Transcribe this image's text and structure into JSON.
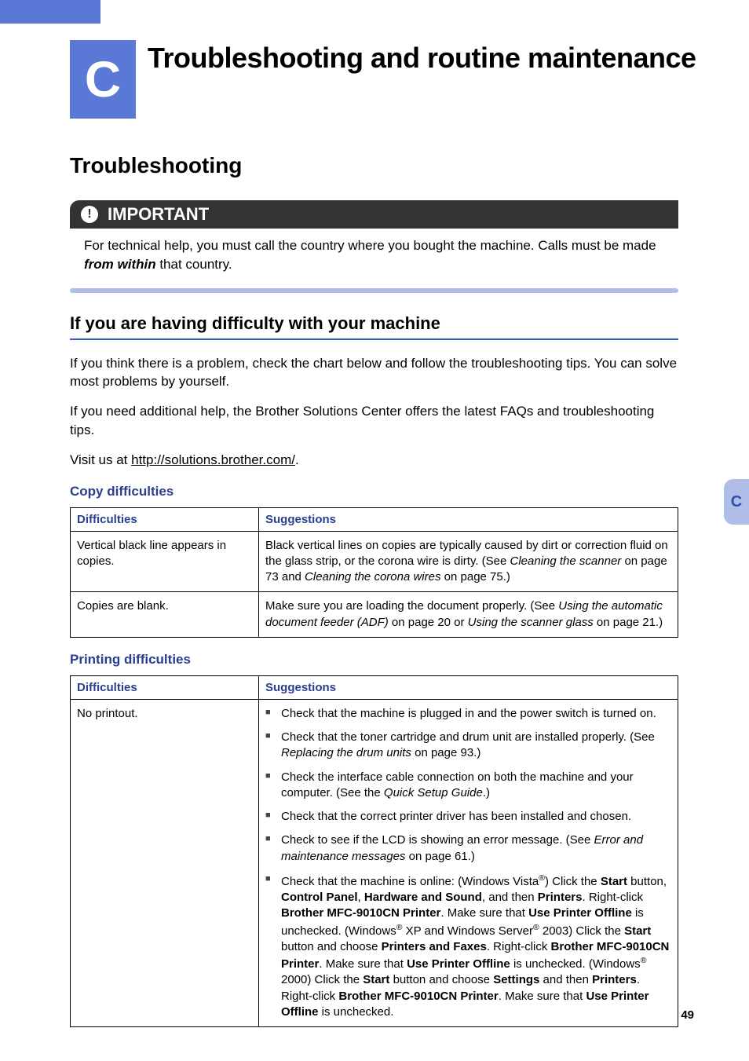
{
  "header": {
    "letter": "C",
    "title": "Troubleshooting and routine maintenance"
  },
  "section_title": "Troubleshooting",
  "important": {
    "label": "IMPORTANT",
    "text_before": "For technical help, you must call the country where you bought the machine. Calls must be made ",
    "text_em": "from within",
    "text_after": " that country."
  },
  "h2": "If you are having difficulty with your machine",
  "p1": "If you think there is a problem, check the chart below and follow the troubleshooting tips. You can solve most problems by yourself.",
  "p2": "If you need additional help, the Brother Solutions Center offers the latest FAQs and troubleshooting tips.",
  "p3_pre": "Visit us at ",
  "p3_url": "http://solutions.brother.com/",
  "p3_post": ".",
  "copy": {
    "title": "Copy difficulties",
    "h_diff": "Difficulties",
    "h_sugg": "Suggestions",
    "r1_d": "Vertical black line appears in copies.",
    "r1_s_a": "Black vertical lines on copies are typically caused by dirt or correction fluid on the glass strip, or the corona wire is dirty. (See ",
    "r1_s_b": "Cleaning the scanner",
    "r1_s_c": " on page 73 and ",
    "r1_s_d": "Cleaning the corona wires",
    "r1_s_e": " on page 75.)",
    "r2_d": "Copies are blank.",
    "r2_s_a": "Make sure you are loading the document properly. (See ",
    "r2_s_b": "Using the automatic document feeder (ADF)",
    "r2_s_c": " on page 20 or ",
    "r2_s_d": "Using the scanner glass",
    "r2_s_e": " on page 21.)"
  },
  "print": {
    "title": "Printing difficulties",
    "h_diff": "Difficulties",
    "h_sugg": "Suggestions",
    "r1_d": "No printout.",
    "li1": "Check that the machine is plugged in and the power switch is turned on.",
    "li2_a": "Check that the toner cartridge and drum unit are installed properly. (See ",
    "li2_b": "Replacing the drum units",
    "li2_c": " on page 93.)",
    "li3_a": "Check the interface cable connection on both the machine and your computer. (See the ",
    "li3_b": "Quick Setup Guide",
    "li3_c": ".)",
    "li4": "Check that the correct printer driver has been installed and chosen.",
    "li5_a": "Check to see if the LCD is showing an error message. (See ",
    "li5_b": "Error and maintenance messages",
    "li5_c": " on page 61.)",
    "li6_a": "Check that the machine is online: (Windows Vista",
    "li6_b": ") Click the ",
    "li6_c": "Start",
    "li6_d": " button, ",
    "li6_e": "Control Panel",
    "li6_f": ", ",
    "li6_g": "Hardware and Sound",
    "li6_h": ", and then ",
    "li6_i": "Printers",
    "li6_j": ". Right-click ",
    "li6_k": "Brother MFC-9010CN Printer",
    "li6_l": ". Make sure that ",
    "li6_m": "Use Printer Offline",
    "li6_n": " is unchecked. (Windows",
    "li6_o": " XP and Windows Server",
    "li6_p": " 2003) Click the ",
    "li6_q": "Start",
    "li6_r": " button and choose ",
    "li6_s": "Printers and Faxes",
    "li6_t": ". Right-click ",
    "li6_u": "Brother MFC-9010CN Printer",
    "li6_v": ". Make sure that ",
    "li6_w": "Use Printer Offline",
    "li6_x": " is unchecked. (Windows",
    "li6_y": " 2000) Click the ",
    "li6_z": "Start",
    "li6_aa": " button and choose ",
    "li6_ab": "Settings",
    "li6_ac": " and then ",
    "li6_ad": "Printers",
    "li6_ae": ". Right-click ",
    "li6_af": "Brother MFC-9010CN Printer",
    "li6_ag": ". Make sure that ",
    "li6_ah": "Use Printer Offline",
    "li6_ai": " is unchecked."
  },
  "side_tab": "C",
  "page_number": "49"
}
